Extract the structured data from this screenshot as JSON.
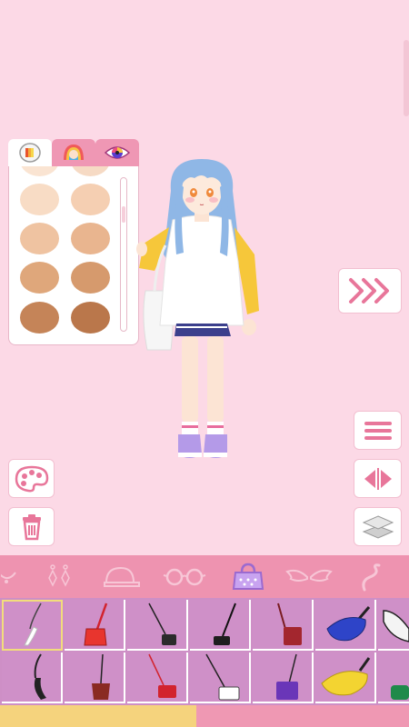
{
  "colors": {
    "background": "#fcd9e6",
    "accent": "#e8769a",
    "category_bar": "#ee93b0",
    "items_bg": "#ce8fc6",
    "progress_fill": "#f5d37d"
  },
  "palette": {
    "tabs": [
      {
        "icon": "makeup-palette-icon",
        "active": true
      },
      {
        "icon": "rainbow-hair-icon",
        "active": false
      },
      {
        "icon": "eye-color-icon",
        "active": false
      }
    ],
    "skin_swatches": [
      "#f8dcc5",
      "#f5cfb2",
      "#efc3a1",
      "#e9b58f",
      "#dfa77b",
      "#d69a6d",
      "#c58458",
      "#ba774b"
    ]
  },
  "side_buttons": {
    "next": "triple-chevron-right-icon",
    "menu": "hamburger-menu-icon",
    "flip": "mirror-flip-icon",
    "layers": "layers-icon",
    "paint": "paint-palette-icon",
    "delete": "trash-icon"
  },
  "categories": [
    {
      "icon": "necklace-icon",
      "active": false
    },
    {
      "icon": "earrings-icon",
      "active": false
    },
    {
      "icon": "cap-icon",
      "active": false
    },
    {
      "icon": "glasses-icon",
      "active": false
    },
    {
      "icon": "handbag-icon",
      "active": true
    },
    {
      "icon": "wings-icon",
      "active": false
    },
    {
      "icon": "tail-icon",
      "active": false
    }
  ],
  "items": [
    {
      "icon": "white-baguette-bag-icon",
      "color": "#ffffff",
      "selected": true
    },
    {
      "icon": "red-crossbody-bag-icon",
      "color": "#e8352e",
      "selected": false
    },
    {
      "icon": "black-shoulder-bag-icon",
      "color": "#2b2b2b",
      "selected": false
    },
    {
      "icon": "black-mini-bag-icon",
      "color": "#1e1e1e",
      "selected": false
    },
    {
      "icon": "maroon-crossbody-bag-icon",
      "color": "#a3262e",
      "selected": false
    },
    {
      "icon": "blue-belt-bag-icon",
      "color": "#2e44c8",
      "selected": false
    },
    {
      "icon": "white-belt-bag-icon",
      "color": "#f4f4f4",
      "selected": false
    },
    {
      "icon": "black-baguette-bag-icon",
      "color": "#222222",
      "selected": false
    },
    {
      "icon": "brown-bucket-bag-icon",
      "color": "#8a2a22",
      "selected": false
    },
    {
      "icon": "red-chain-bag-icon",
      "color": "#d2232e",
      "selected": false
    },
    {
      "icon": "white-chain-bag-icon",
      "color": "#ffffff",
      "selected": false
    },
    {
      "icon": "purple-crossbody-bag-icon",
      "color": "#6a36b8",
      "selected": false
    },
    {
      "icon": "yellow-belt-bag-icon",
      "color": "#f3d431",
      "selected": false
    },
    {
      "icon": "green-bag-icon",
      "color": "#1f8a4a",
      "selected": false
    }
  ],
  "progress": {
    "fraction": 0.48
  }
}
